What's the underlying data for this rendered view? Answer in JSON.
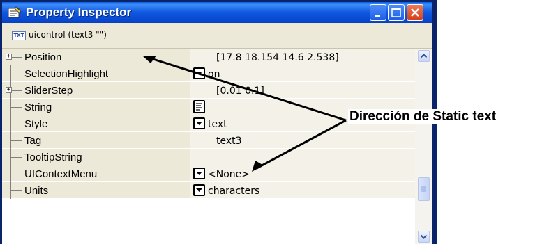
{
  "window": {
    "title": "Property Inspector",
    "object_label": "uicontrol (text3 \"\")",
    "object_icon_text": "TXT",
    "title_icon": "inspector-icon"
  },
  "properties": [
    {
      "name": "Position",
      "value": "[17.8 18.154 14.6 2.538]",
      "control": "none",
      "expandable": true
    },
    {
      "name": "SelectionHighlight",
      "value": "on",
      "control": "dropdown",
      "expandable": false
    },
    {
      "name": "SliderStep",
      "value": "[0.01 0.1]",
      "control": "none",
      "expandable": true
    },
    {
      "name": "String",
      "value": "",
      "control": "edit",
      "expandable": false
    },
    {
      "name": "Style",
      "value": "text",
      "control": "dropdown",
      "expandable": false
    },
    {
      "name": "Tag",
      "value": "text3",
      "control": "none",
      "expandable": false
    },
    {
      "name": "TooltipString",
      "value": "",
      "control": "none",
      "expandable": false
    },
    {
      "name": "UIContextMenu",
      "value": "<None>",
      "control": "dropdown",
      "expandable": false
    },
    {
      "name": "Units",
      "value": "characters",
      "control": "dropdown",
      "expandable": false
    }
  ],
  "annotation": {
    "text": "Dirección de Static text"
  },
  "colors": {
    "titlebar": "#0a5ee5",
    "close_button": "#d2401b",
    "panel": "#ece9d8"
  }
}
